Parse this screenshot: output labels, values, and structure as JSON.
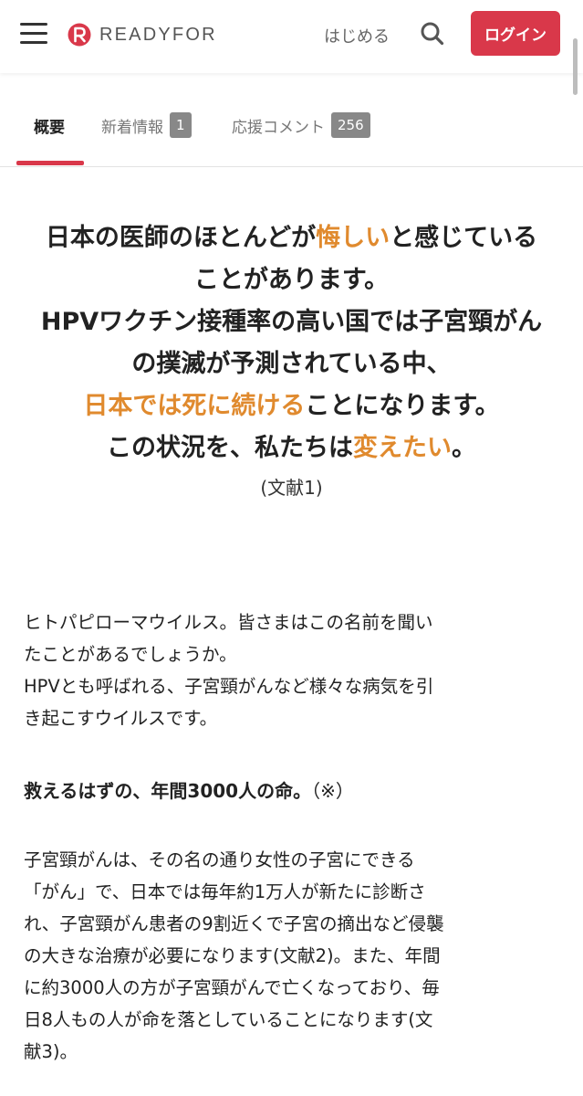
{
  "header": {
    "menu_icon": "hamburger-menu-icon",
    "brand": "READYFOR",
    "brand_color": "#d9384a",
    "start_label": "はじめる",
    "search_icon": "search-icon",
    "login_label": "ログイン"
  },
  "tabs": [
    {
      "label": "概要",
      "active": true
    },
    {
      "label": "新着情報",
      "badge": "1"
    },
    {
      "label": "応援コメント",
      "badge": "256"
    }
  ],
  "headline": {
    "line1_a": "日本の医師のほとんどが",
    "line1_hl": "悔しい",
    "line1_b": "と感じている",
    "line2": "ことがあります。",
    "line3": "HPVワクチン接種率の高い国では子宮頸がん",
    "line4": "の撲滅が予測されている中、",
    "line5_hl": "日本では死に続ける",
    "line5_b": "ことになります。",
    "line6_a": "この状況を、私たちは",
    "line6_hl": "変えたい",
    "line6_b": "。",
    "reference": "(文献1)",
    "highlight_color": "#e08a2e"
  },
  "body": {
    "p1_l1": "ヒトパピローマウイルス。皆さまはこの名前を聞い",
    "p1_l2": "たことがあるでしょうか。",
    "p1_l3": "HPVとも呼ばれる、子宮頸がんなど様々な病気を引",
    "p1_l4": "き起こすウイルスです。",
    "heading": "救えるはずの、年間3000人の命。",
    "heading_note": "（※）",
    "p2_l1": "子宮頸がんは、その名の通り女性の子宮にできる",
    "p2_l2": "「がん」で、日本では毎年約1万人が新たに診断さ",
    "p2_l3": "れ、子宮頸がん患者の9割近くで子宮の摘出など侵襲",
    "p2_l4": "の大きな治療が必要になります(文献2)。また、年間",
    "p2_l5": "に約3000人の方が子宮頸がんで亡くなっており、毎",
    "p2_l6": "日8人もの人が命を落としていることになります(文",
    "p2_l7": "献3)。"
  }
}
